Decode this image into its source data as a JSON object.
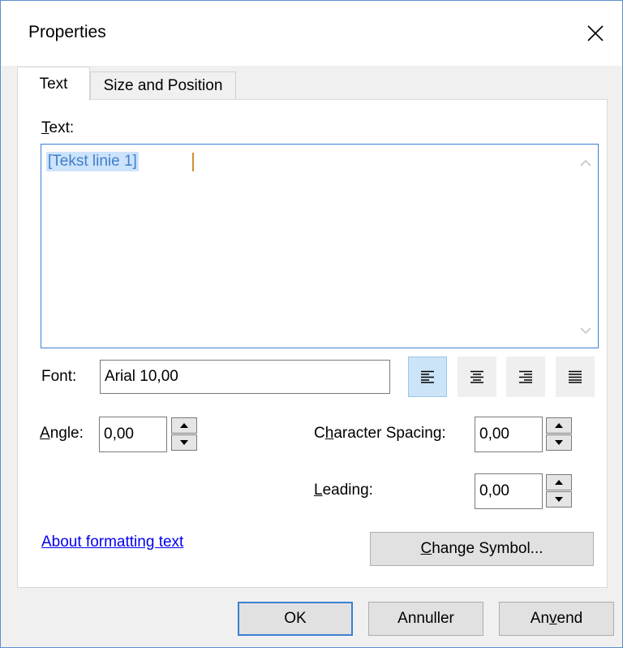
{
  "window": {
    "title": "Properties"
  },
  "tabs": [
    {
      "label": "Text",
      "active": true
    },
    {
      "label": "Size and Position",
      "active": false
    }
  ],
  "text_section": {
    "label_accel": "T",
    "label_rest": "ext:",
    "value": "[Tekst linie 1]"
  },
  "font": {
    "label": "Font:",
    "value": "Arial 10,00"
  },
  "alignment": {
    "buttons": [
      {
        "icon": "align-left-icon",
        "active": true
      },
      {
        "icon": "align-center-icon",
        "active": false
      },
      {
        "icon": "align-right-icon",
        "active": false
      },
      {
        "icon": "align-justify-icon",
        "active": false
      }
    ]
  },
  "angle": {
    "label_accel": "A",
    "label_rest": "ngle:",
    "value": "0,00"
  },
  "character_spacing": {
    "label_pre": "C",
    "label_accel": "h",
    "label_rest": "aracter Spacing:",
    "value": "0,00"
  },
  "leading": {
    "label_accel": "L",
    "label_rest": "eading:",
    "value": "0,00"
  },
  "about_link": "About formatting text",
  "change_symbol": {
    "label_accel": "C",
    "label_rest": "hange Symbol..."
  },
  "footer": {
    "ok": "OK",
    "cancel": "Annuller",
    "apply_pre": "An",
    "apply_accel": "v",
    "apply_rest": "end"
  },
  "colors": {
    "accent": "#3c7fd3",
    "link": "#0000ee",
    "selection": "#cce3fb"
  }
}
